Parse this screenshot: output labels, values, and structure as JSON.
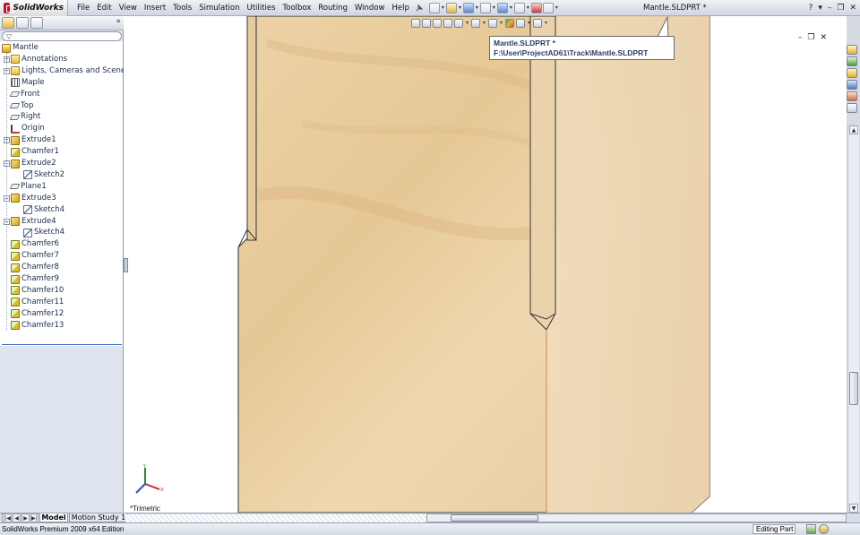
{
  "app": {
    "name": "SolidWorks",
    "document_title": "Mantle.SLDPRT *",
    "help_label": "?"
  },
  "menu": [
    "File",
    "Edit",
    "View",
    "Insert",
    "Tools",
    "Simulation",
    "Utilities",
    "Toolbox",
    "Routing",
    "Window",
    "Help"
  ],
  "feature_tree": [
    {
      "label": "Mantle",
      "icon": "part-icon",
      "level": 0,
      "expander": ""
    },
    {
      "label": "Annotations",
      "icon": "annotations-folder-icon",
      "level": 1,
      "expander": "+"
    },
    {
      "label": "Lights, Cameras and Scene",
      "icon": "lights-folder-icon",
      "level": 1,
      "expander": "+"
    },
    {
      "label": "Maple",
      "icon": "material-icon",
      "level": 1,
      "expander": ""
    },
    {
      "label": "Front",
      "icon": "plane-icon",
      "level": 1,
      "expander": ""
    },
    {
      "label": "Top",
      "icon": "plane-icon",
      "level": 1,
      "expander": ""
    },
    {
      "label": "Right",
      "icon": "plane-icon",
      "level": 1,
      "expander": ""
    },
    {
      "label": "Origin",
      "icon": "origin-icon",
      "level": 1,
      "expander": ""
    },
    {
      "label": "Extrude1",
      "icon": "extrude-icon",
      "level": 1,
      "expander": "+"
    },
    {
      "label": "Chamfer1",
      "icon": "chamfer-icon",
      "level": 1,
      "expander": ""
    },
    {
      "label": "Extrude2",
      "icon": "extrude-icon",
      "level": 1,
      "expander": "−"
    },
    {
      "label": "Sketch2",
      "icon": "sketch-icon",
      "level": 2,
      "expander": ""
    },
    {
      "label": "Plane1",
      "icon": "plane-icon",
      "level": 1,
      "expander": ""
    },
    {
      "label": "Extrude3",
      "icon": "extrude-icon",
      "level": 1,
      "expander": "−"
    },
    {
      "label": "Sketch4",
      "icon": "sketch-icon",
      "level": 2,
      "expander": ""
    },
    {
      "label": "Extrude4",
      "icon": "extrude-icon",
      "level": 1,
      "expander": "−"
    },
    {
      "label": "Sketch4",
      "icon": "sketch-icon",
      "level": 2,
      "expander": ""
    },
    {
      "label": "Chamfer6",
      "icon": "chamfer-icon",
      "level": 1,
      "expander": ""
    },
    {
      "label": "Chamfer7",
      "icon": "chamfer-icon",
      "level": 1,
      "expander": ""
    },
    {
      "label": "Chamfer8",
      "icon": "chamfer-icon",
      "level": 1,
      "expander": ""
    },
    {
      "label": "Chamfer9",
      "icon": "chamfer-icon",
      "level": 1,
      "expander": ""
    },
    {
      "label": "Chamfer10",
      "icon": "chamfer-icon",
      "level": 1,
      "expander": ""
    },
    {
      "label": "Chamfer11",
      "icon": "chamfer-icon",
      "level": 1,
      "expander": ""
    },
    {
      "label": "Chamfer12",
      "icon": "chamfer-icon",
      "level": 1,
      "expander": ""
    },
    {
      "label": "Chamfer13",
      "icon": "chamfer-icon",
      "level": 1,
      "expander": ""
    }
  ],
  "tooltip": {
    "line1": "Mantle.SLDPRT *",
    "line2": "F:\\User\\ProjectAD61\\Track\\Mantle.SLDPRT"
  },
  "viewport": {
    "view_orientation": "*Trimetric",
    "part_color": "#e9cfa4"
  },
  "bottom_tabs": {
    "model": "Model",
    "motion": "Motion Study 1"
  },
  "status": {
    "text": "SolidWorks Premium 2009 x64 Edition",
    "mode": "Editing Part"
  }
}
